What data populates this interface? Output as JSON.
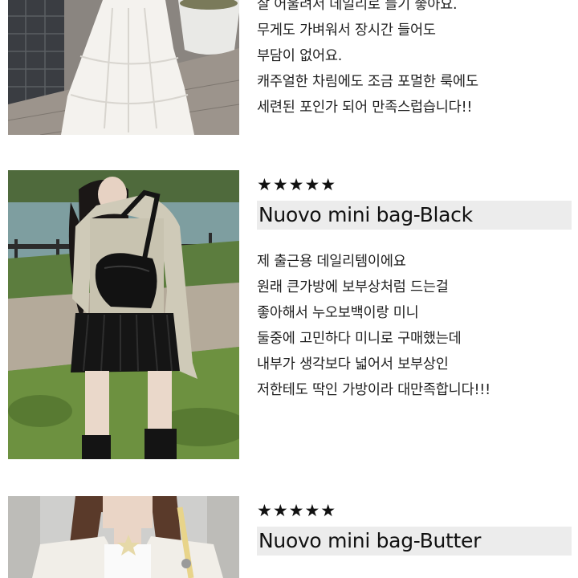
{
  "reviews": [
    {
      "stars": "",
      "product": "",
      "lines": [
        "잘 어울려서 데일리로 들기 좋아요.",
        "무게도 가벼워서 장시간 들어도",
        "부담이 없어요.",
        "캐주얼한 차림에도 조금 포멀한 룩에도",
        "세련된 포인가 되어 만족스럽습니다!!"
      ]
    },
    {
      "stars": "★★★★★",
      "product": "Nuovo mini bag-Black",
      "lines": [
        "제 출근용 데일리템이에요",
        "원래 큰가방에 보부상처럼 드는걸",
        "좋아해서 누오보백이랑 미니",
        "둘중에 고민하다 미니로 구매했는데",
        "내부가 생각보다 넓어서 보부상인",
        "저한테도 딱인 가방이라 대만족합니다!!!"
      ]
    },
    {
      "stars": "★★★★★",
      "product": "Nuovo mini bag-Butter",
      "lines": []
    }
  ],
  "colors": {
    "product_bar_bg": "#ececec",
    "text": "#1e1e1e",
    "bag_black": "#1a1a1a",
    "bag_butter": "#e8d48a"
  }
}
